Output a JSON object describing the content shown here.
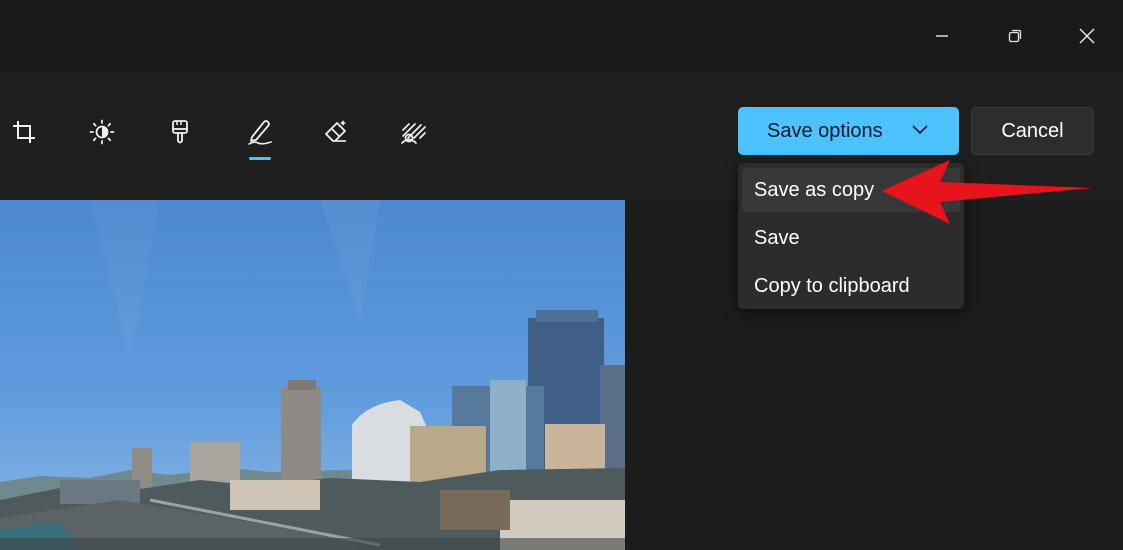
{
  "window": {
    "minimize_icon": "minimize-icon",
    "maximize_icon": "restore-icon",
    "close_icon": "close-icon"
  },
  "toolbar": {
    "tools": [
      {
        "name": "crop",
        "icon": "crop-icon"
      },
      {
        "name": "adjustment",
        "icon": "brightness-icon"
      },
      {
        "name": "filter",
        "icon": "filter-icon"
      },
      {
        "name": "markup",
        "icon": "markup-pen-icon",
        "selected": true
      },
      {
        "name": "erase",
        "icon": "eraser-icon"
      },
      {
        "name": "background",
        "icon": "background-blur-icon"
      }
    ],
    "accent_color": "#4cc2ff"
  },
  "actions": {
    "save_options_label": "Save options",
    "cancel_label": "Cancel"
  },
  "save_menu": {
    "items": [
      {
        "label": "Save as copy",
        "highlighted": true
      },
      {
        "label": "Save"
      },
      {
        "label": "Copy to clipboard"
      }
    ]
  },
  "annotation": {
    "arrow_color": "#e8141b"
  },
  "canvas": {
    "image": "city-skyline-photo"
  }
}
